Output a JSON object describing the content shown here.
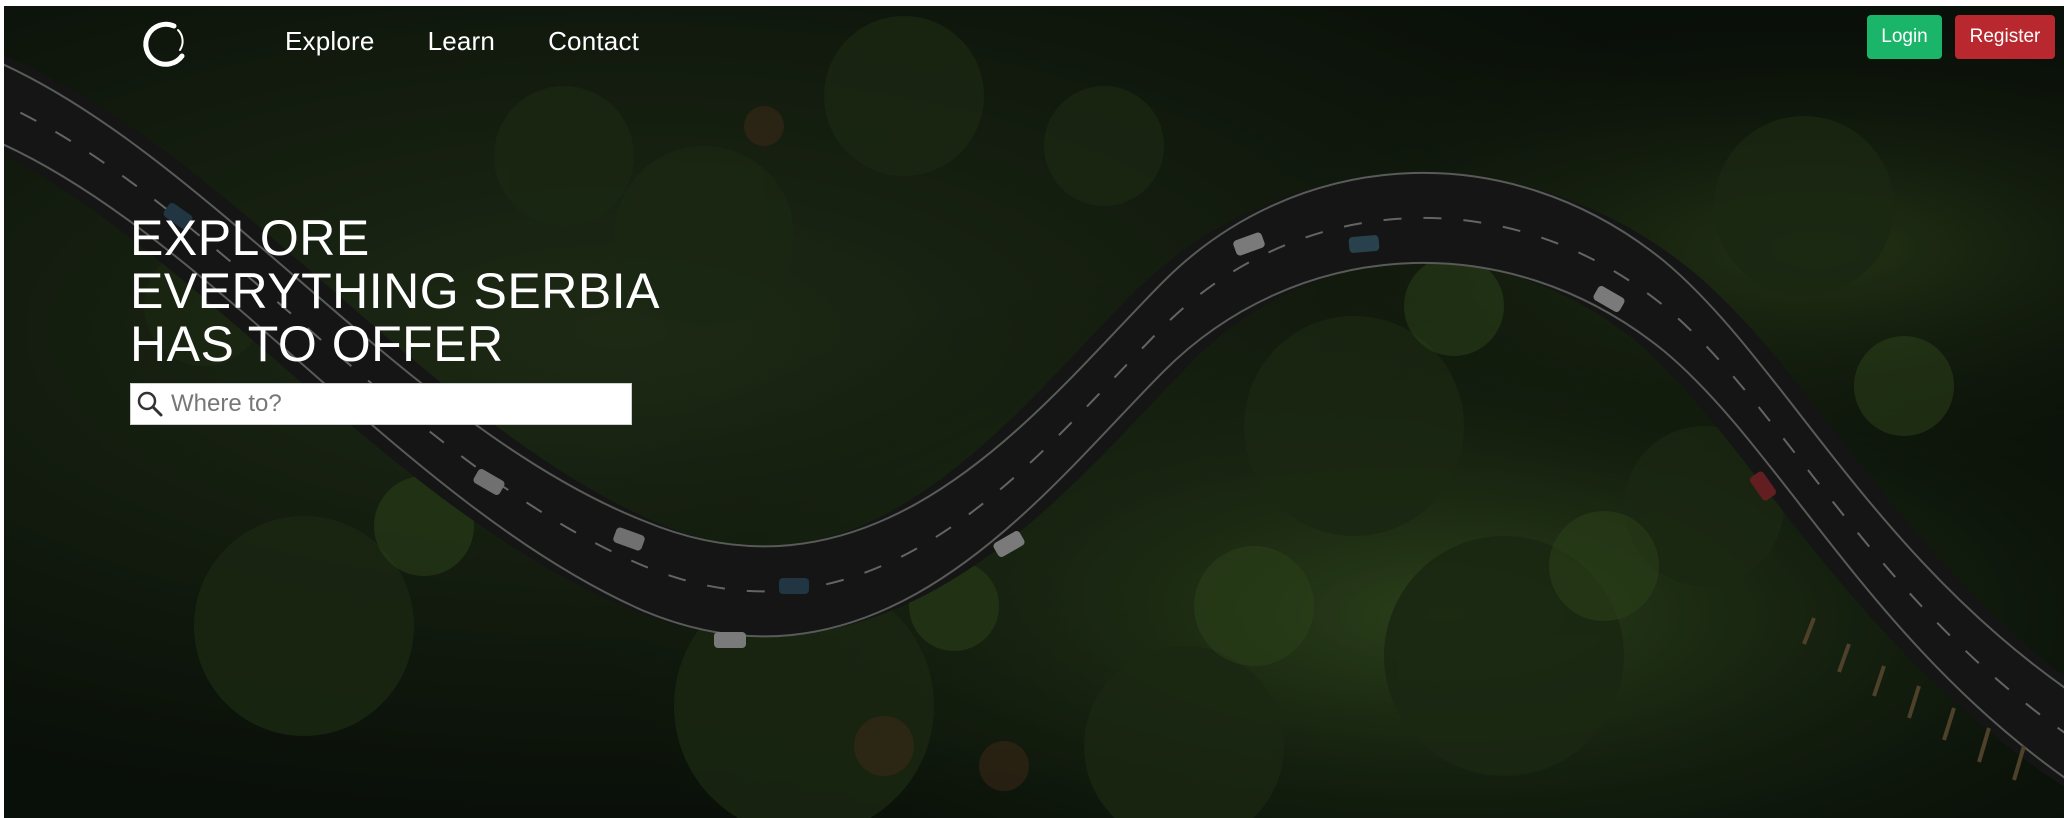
{
  "nav": {
    "logo": "logo-icon",
    "links": [
      "Explore",
      "Learn",
      "Contact"
    ],
    "login_label": "Login",
    "register_label": "Register"
  },
  "hero": {
    "headline_lines": [
      "EXPLORE",
      "EVERYTHING SERBIA",
      "HAS TO OFFER"
    ],
    "search": {
      "icon": "search-icon",
      "placeholder": "Where to?",
      "value": ""
    }
  },
  "colors": {
    "login_bg": "#1bb56a",
    "register_bg": "#b8282e",
    "text": "#ffffff"
  }
}
